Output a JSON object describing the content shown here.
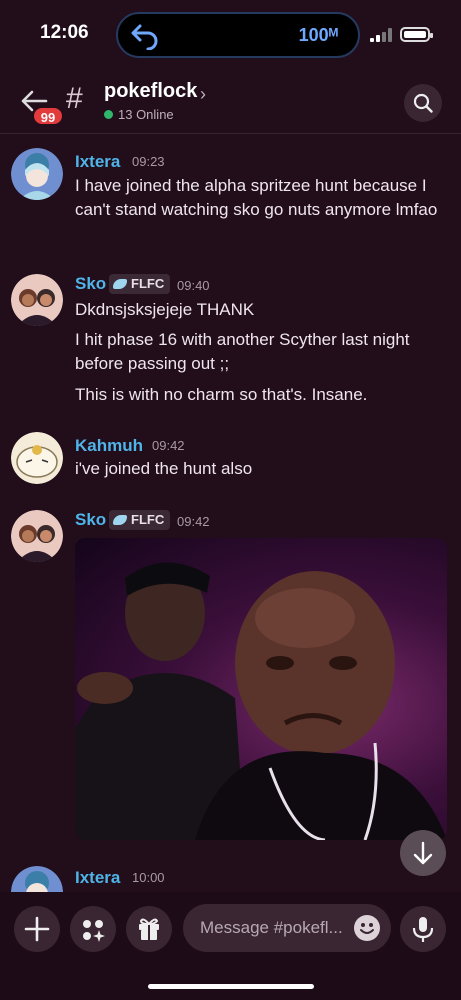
{
  "status_bar": {
    "time": "12:06",
    "zoom_indicator": "100ᴹ"
  },
  "header": {
    "unread_badge": "99",
    "channel_name": "pokeflock",
    "online_count": "13 Online"
  },
  "messages": [
    {
      "author": "Ixtera",
      "time": "09:23",
      "lines": [
        "I have joined the alpha spritzee hunt because I can't stand watching sko go nuts anymore lmfao"
      ]
    },
    {
      "author": "Sko",
      "tag": "FLFC",
      "time": "09:40",
      "lines": [
        "Dkdnsjsksjejeje THANK",
        "I hit phase 16 with another Scyther last night before passing out ;;",
        "This is with no charm so that's. Insane."
      ]
    },
    {
      "author": "Kahmuh",
      "time": "09:42",
      "lines": [
        "i've joined the hunt also"
      ]
    },
    {
      "author": "Sko",
      "tag": "FLFC",
      "time": "09:42",
      "attachment": "gif"
    },
    {
      "author": "Ixtera",
      "time": "10:00"
    }
  ],
  "composer": {
    "placeholder": "Message #pokefl..."
  },
  "colors": {
    "background": "#220d1b",
    "author_name": "#4fb4e8",
    "online": "#2fb66b",
    "badge": "#e23b3b"
  }
}
